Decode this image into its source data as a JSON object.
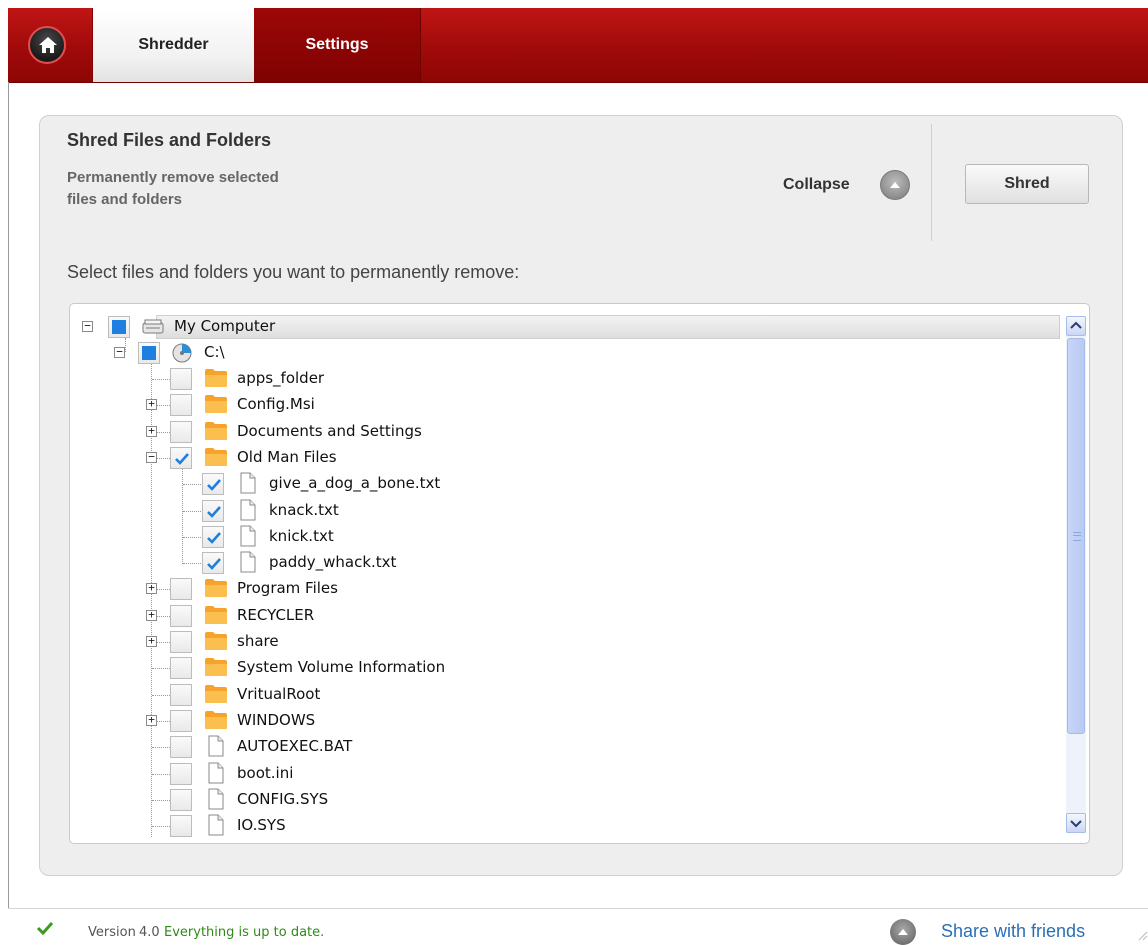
{
  "tabs": {
    "shredder": "Shredder",
    "settings": "Settings"
  },
  "panel": {
    "title": "Shred Files and Folders",
    "description": "Permanently remove selected\nfiles and folders",
    "collapse_label": "Collapse",
    "shred_label": "Shred",
    "prompt": "Select files and folders you want to permanently remove:"
  },
  "tree": {
    "root": "My Computer",
    "drive": "C:\\",
    "items": [
      {
        "label": "apps_folder",
        "type": "folder",
        "expandable": false,
        "state": "unchecked"
      },
      {
        "label": "Config.Msi",
        "type": "folder",
        "expandable": true,
        "state": "unchecked"
      },
      {
        "label": "Documents and Settings",
        "type": "folder",
        "expandable": true,
        "state": "unchecked"
      },
      {
        "label": "Old Man Files",
        "type": "folder",
        "expandable": true,
        "expanded": true,
        "state": "checked"
      },
      {
        "label": "give_a_dog_a_bone.txt",
        "type": "file",
        "child": true,
        "state": "checked"
      },
      {
        "label": "knack.txt",
        "type": "file",
        "child": true,
        "state": "checked"
      },
      {
        "label": "knick.txt",
        "type": "file",
        "child": true,
        "state": "checked"
      },
      {
        "label": "paddy_whack.txt",
        "type": "file",
        "child": true,
        "state": "checked"
      },
      {
        "label": "Program Files",
        "type": "folder",
        "expandable": true,
        "state": "unchecked"
      },
      {
        "label": "RECYCLER",
        "type": "folder",
        "expandable": true,
        "state": "unchecked"
      },
      {
        "label": "share",
        "type": "folder",
        "expandable": true,
        "state": "unchecked"
      },
      {
        "label": "System Volume Information",
        "type": "folder",
        "expandable": false,
        "state": "unchecked"
      },
      {
        "label": "VritualRoot",
        "type": "folder",
        "expandable": false,
        "state": "unchecked"
      },
      {
        "label": "WINDOWS",
        "type": "folder",
        "expandable": true,
        "state": "unchecked"
      },
      {
        "label": "AUTOEXEC.BAT",
        "type": "file",
        "state": "unchecked"
      },
      {
        "label": "boot.ini",
        "type": "file",
        "state": "unchecked"
      },
      {
        "label": "CONFIG.SYS",
        "type": "file",
        "state": "unchecked"
      },
      {
        "label": "IO.SYS",
        "type": "file",
        "state": "unchecked"
      }
    ]
  },
  "status": {
    "version_label": "Version",
    "version_number": "4.0",
    "update_status": "Everything is up to date.",
    "share_label": "Share with friends"
  },
  "colors": {
    "brand_red": "#a00a0a",
    "check_blue": "#1e7fe0",
    "folder_orange": "#f7a32b",
    "link_blue": "#2a6fb6",
    "ok_green": "#2f8a17"
  }
}
